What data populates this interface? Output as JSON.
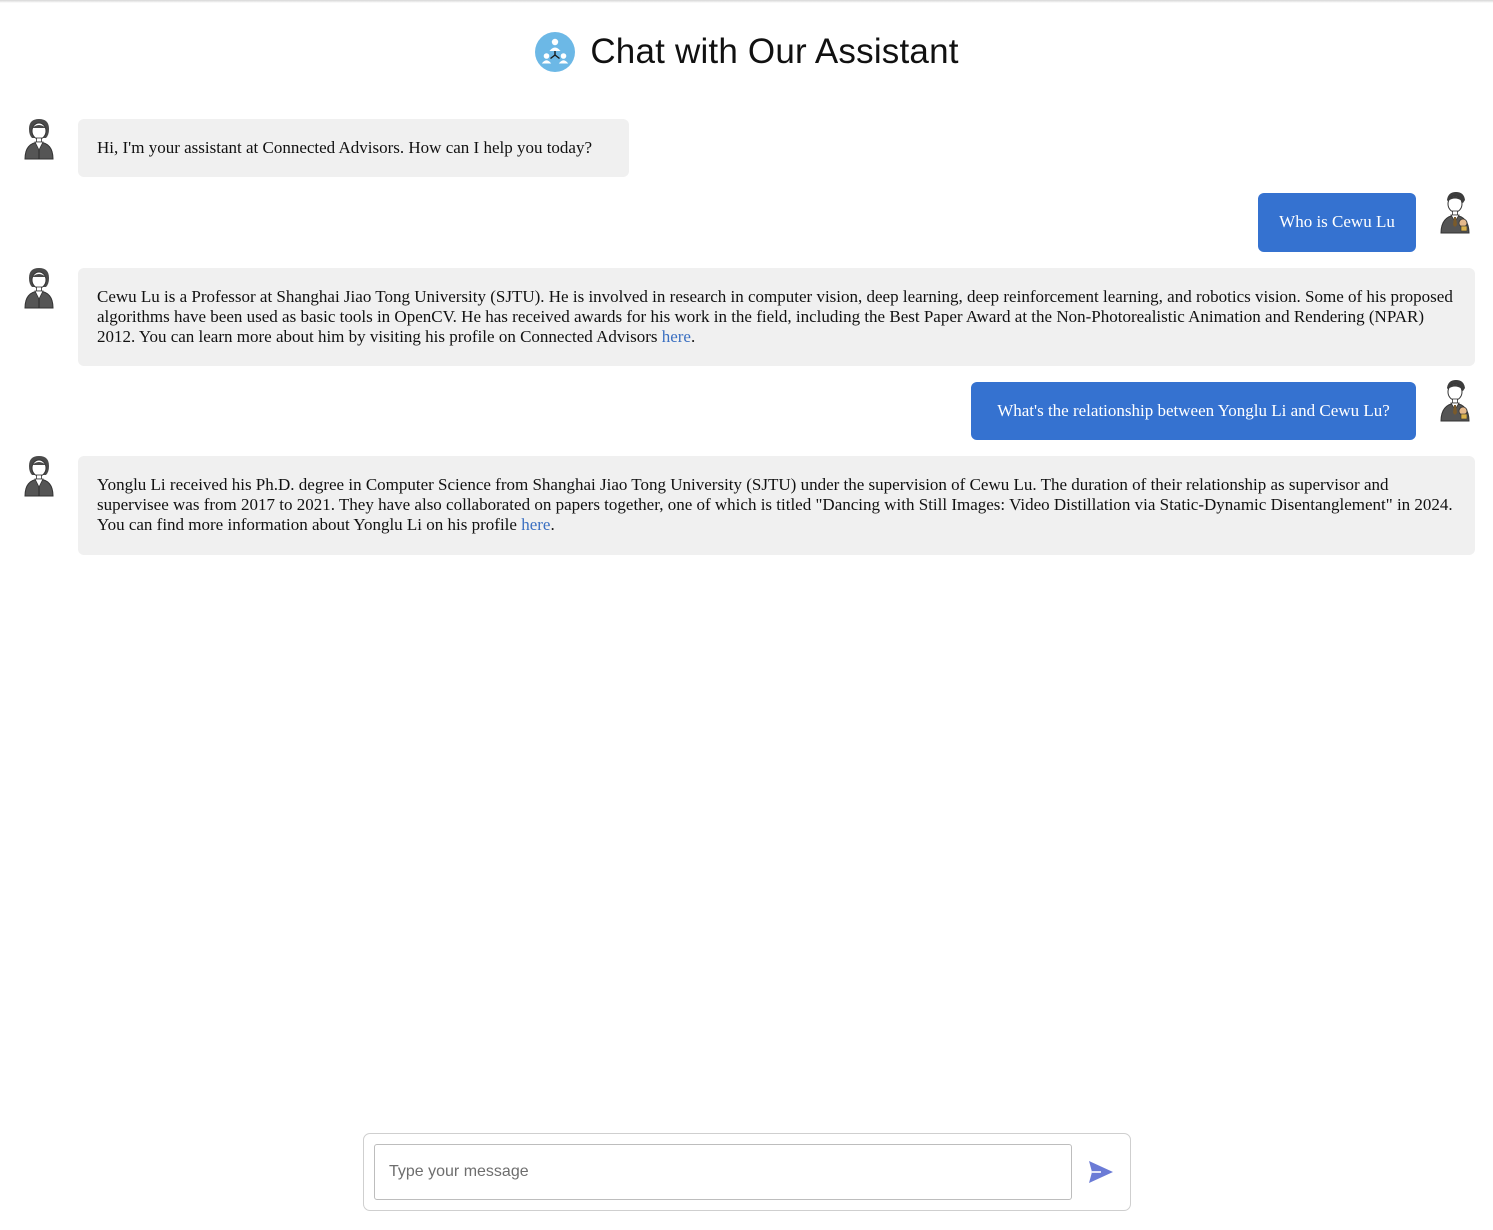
{
  "header": {
    "title": "Chat with Our Assistant",
    "logo_icon": "network-people-icon",
    "logo_color": "#6cb8e6"
  },
  "messages": [
    {
      "role": "assistant",
      "avatar_icon": "assistant-avatar-icon",
      "text": "Hi, I'm your assistant at Connected Advisors. How can I help you today?"
    },
    {
      "role": "user",
      "avatar_icon": "user-avatar-icon",
      "text": "Who is Cewu Lu"
    },
    {
      "role": "assistant",
      "avatar_icon": "assistant-avatar-icon",
      "text": "Cewu Lu is a Professor at Shanghai Jiao Tong University (SJTU). He is involved in research in computer vision, deep learning, deep reinforcement learning, and robotics vision. Some of his proposed algorithms have been used as basic tools in OpenCV. He has received awards for his work in the field, including the Best Paper Award at the Non-Photorealistic Animation and Rendering (NPAR) 2012. You can learn more about him by visiting his profile on Connected Advisors ",
      "link_text": "here",
      "after_link": "."
    },
    {
      "role": "user",
      "avatar_icon": "user-avatar-icon",
      "text": "What's the relationship between Yonglu Li and Cewu Lu?"
    },
    {
      "role": "assistant",
      "avatar_icon": "assistant-avatar-icon",
      "text": "Yonglu Li received his Ph.D. degree in Computer Science from Shanghai Jiao Tong University (SJTU) under the supervision of Cewu Lu. The duration of their relationship as supervisor and supervisee was from 2017 to 2021. They have also collaborated on papers together, one of which is titled \"Dancing with Still Images: Video Distillation via Static-Dynamic Disentanglement\" in 2024. You can find more information about Yonglu Li on his profile ",
      "link_text": "here",
      "after_link": "."
    }
  ],
  "composer": {
    "placeholder": "Type your message",
    "value": "",
    "send_icon": "send-icon"
  },
  "colors": {
    "user_bubble": "#3572d0",
    "assistant_bubble": "#f0f0f0",
    "link": "#3a6fc1",
    "send_icon": "#6b7bd6"
  }
}
